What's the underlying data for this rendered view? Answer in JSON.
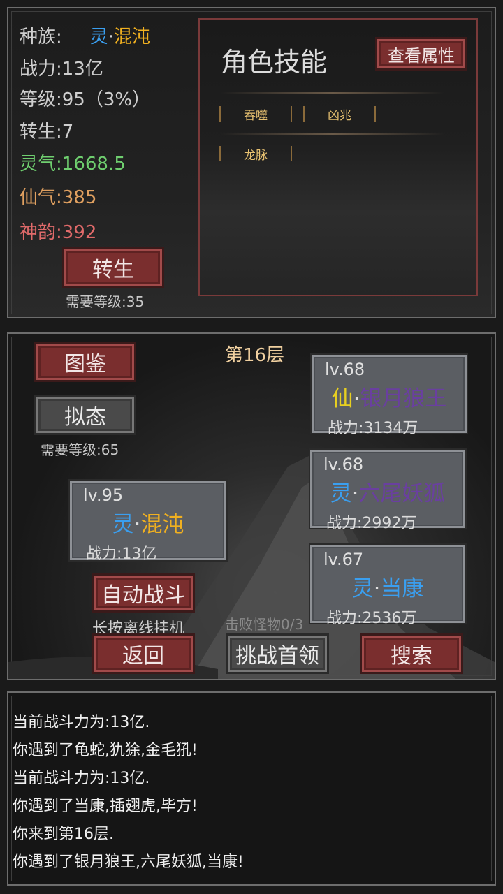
{
  "stats": {
    "race_label": "种族:",
    "race_prefix": "灵",
    "race_dot": "·",
    "race_name": "混沌",
    "power_label": "战力:",
    "power_value": "13亿",
    "level_label": "等级:",
    "level_value": "95（3%）",
    "rebirth_label": "转生:",
    "rebirth_value": "7",
    "spirit_label": "灵气:",
    "spirit_value": "1668.5",
    "immortal_label": "仙气:",
    "immortal_value": "385",
    "divine_label": "神韵:",
    "divine_value": "392",
    "rebirth_button": "转生",
    "rebirth_requirement": "需要等级:35"
  },
  "skills": {
    "title": "角色技能",
    "view_attr_button": "查看属性",
    "items": [
      "吞噬",
      "凶兆",
      "龙脉"
    ]
  },
  "battle": {
    "floor": "第16层",
    "atlas_button": "图鉴",
    "mimic_button": "拟态",
    "mimic_requirement": "需要等级:65",
    "auto_battle_button": "自动战斗",
    "offline_hint": "长按离线挂机",
    "defeat_count": "击败怪物0/3",
    "back_button": "返回",
    "challenge_boss_button": "挑战首领",
    "search_button": "搜索",
    "player": {
      "level": "lv.95",
      "prefix": "灵",
      "dot": "·",
      "name": "混沌",
      "power": "战力:13亿"
    },
    "monsters": [
      {
        "level": "lv.68",
        "prefix": "仙",
        "dot": "·",
        "name": "银月狼王",
        "power": "战力:3134万"
      },
      {
        "level": "lv.68",
        "prefix": "灵",
        "dot": "·",
        "name": "六尾妖狐",
        "power": "战力:2992万"
      },
      {
        "level": "lv.67",
        "prefix": "灵",
        "dot": "·",
        "name": "当康",
        "power": "战力:2536万"
      }
    ]
  },
  "log": [
    "当前战斗力为:13亿.",
    "你遇到了龟蛇,犰狳,金毛犼!",
    "当前战斗力为:13亿.",
    "你遇到了当康,插翅虎,毕方!",
    "你来到第16层.",
    "你遇到了银月狼王,六尾妖狐,当康!"
  ],
  "colors": {
    "spirit": "#6fcf6f",
    "immortal": "#e0a060",
    "divine": "#e06a6a",
    "ling_prefix": "#3a9ff0",
    "xian_prefix": "#e8d020",
    "chaos_name": "#f0b020",
    "monster_name_purple": "#6a3fa0",
    "dangkang_name": "#3a9ff0"
  }
}
